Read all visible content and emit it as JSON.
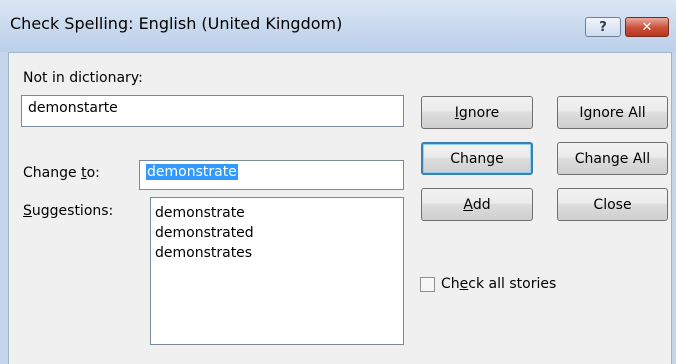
{
  "window": {
    "title": "Check Spelling: English (United Kingdom)",
    "help_label": "?",
    "close_label": "✕"
  },
  "not_in_dictionary": {
    "label": "Not in dictionary:",
    "value": "demonstarte"
  },
  "change_to": {
    "label_pre": "Change ",
    "label_ul": "t",
    "label_post": "o:",
    "value": "demonstrate"
  },
  "suggestions": {
    "label_ul": "S",
    "label_post": "uggestions:",
    "items": [
      "demonstrate",
      "demonstrated",
      "demonstrates"
    ]
  },
  "buttons": {
    "ignore": {
      "ul": "I",
      "rest": "gnore"
    },
    "ignore_all": "Ignore All",
    "change": "Change",
    "change_all": "Change All",
    "add": {
      "ul": "A",
      "rest": "dd"
    },
    "close": "Close"
  },
  "check_all_stories": {
    "pre": "Ch",
    "ul": "e",
    "post": "ck all stories",
    "checked": false
  }
}
